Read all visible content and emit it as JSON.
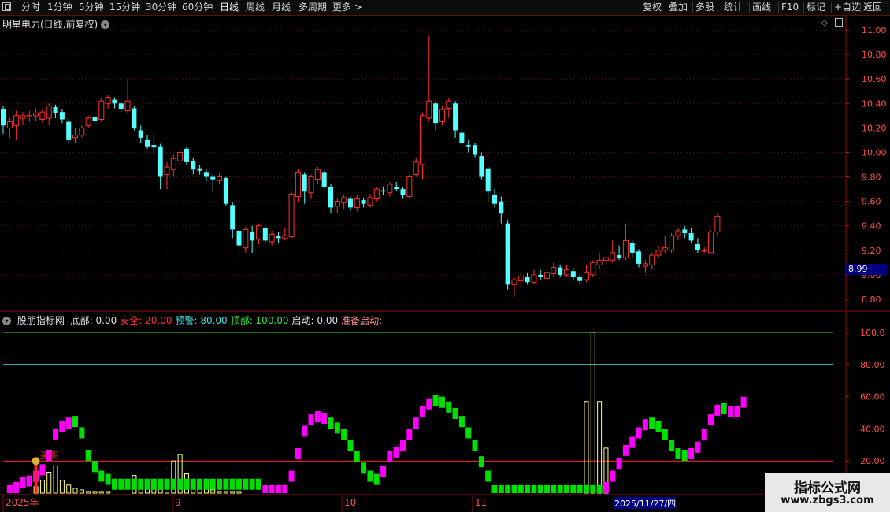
{
  "toolbar": {
    "periods": [
      "分时",
      "1分钟",
      "5分钟",
      "15分钟",
      "30分钟",
      "60分钟",
      "日线",
      "周线",
      "月线",
      "多周期",
      "更多 >"
    ],
    "active_period": "日线",
    "actions": [
      "复权",
      "叠加",
      "多股",
      "统计",
      "画线",
      "F10",
      "标记",
      "+自选",
      "返回"
    ]
  },
  "stock": {
    "title": "明星电力(日线,前复权)",
    "last_price_badge": "8.99"
  },
  "indicator": {
    "name": "股朋指标网",
    "items": [
      {
        "label": "底部:",
        "value": "0.00",
        "color": "#e0e0e0"
      },
      {
        "label": "安全:",
        "value": "20.00",
        "color": "#ff3030"
      },
      {
        "label": "预警:",
        "value": "80.00",
        "color": "#40e0e0"
      },
      {
        "label": "顶部:",
        "value": "100.00",
        "color": "#30e030"
      },
      {
        "label": "启动:",
        "value": "0.00",
        "color": "#e0e0e0"
      },
      {
        "label": "准备启动:",
        "value": "",
        "color": "#ff9090"
      }
    ],
    "buy_label": "买买"
  },
  "price_axis": [
    "11.00",
    "10.80",
    "10.60",
    "10.40",
    "10.20",
    "10.00",
    "9.80",
    "9.60",
    "9.40",
    "9.20",
    "9.00",
    "8.80"
  ],
  "indicator_axis": [
    "100.0",
    "80.00",
    "60.00",
    "40.00",
    "20.00"
  ],
  "date_axis": [
    "2025年",
    "9",
    "10",
    "11"
  ],
  "cursor_date": "2025/11/27/四",
  "watermark": {
    "line1": "指标公式网",
    "line2": "www.zbgs3.com"
  },
  "colors": {
    "up": "#ff3030",
    "down": "#54ffff",
    "ind_up": "#ff00ff",
    "ind_down": "#00e000",
    "low_bar": "#ffff80"
  },
  "chart_data": {
    "type": "candlestick",
    "price_ylim": [
      8.7,
      11.05
    ],
    "candles": [
      [
        10.35,
        10.22,
        10.38,
        10.15
      ],
      [
        10.2,
        10.25,
        10.28,
        10.12
      ],
      [
        10.22,
        10.3,
        10.34,
        10.1
      ],
      [
        10.28,
        10.3,
        10.33,
        10.22
      ],
      [
        10.29,
        10.3,
        10.34,
        10.25
      ],
      [
        10.3,
        10.32,
        10.36,
        10.26
      ],
      [
        10.27,
        10.33,
        10.35,
        10.24
      ],
      [
        10.28,
        10.38,
        10.4,
        10.22
      ],
      [
        10.37,
        10.32,
        10.39,
        10.28
      ],
      [
        10.33,
        10.27,
        10.35,
        10.24
      ],
      [
        10.25,
        10.1,
        10.27,
        10.08
      ],
      [
        10.12,
        10.14,
        10.2,
        10.08
      ],
      [
        10.14,
        10.2,
        10.22,
        10.12
      ],
      [
        10.22,
        10.28,
        10.3,
        10.2
      ],
      [
        10.29,
        10.26,
        10.32,
        10.22
      ],
      [
        10.27,
        10.42,
        10.44,
        10.25
      ],
      [
        10.4,
        10.45,
        10.47,
        10.35
      ],
      [
        10.43,
        10.4,
        10.45,
        10.36
      ],
      [
        10.4,
        10.35,
        10.42,
        10.33
      ],
      [
        10.34,
        10.42,
        10.6,
        10.32
      ],
      [
        10.36,
        10.2,
        10.38,
        10.18
      ],
      [
        10.18,
        10.12,
        10.22,
        10.08
      ],
      [
        10.1,
        10.05,
        10.14,
        10.03
      ],
      [
        10.06,
        10.04,
        10.15,
        9.99
      ],
      [
        10.05,
        9.8,
        10.07,
        9.7
      ],
      [
        9.82,
        9.88,
        9.92,
        9.7
      ],
      [
        9.86,
        9.95,
        9.98,
        9.8
      ],
      [
        9.93,
        10.0,
        10.03,
        9.9
      ],
      [
        10.03,
        9.92,
        10.05,
        9.9
      ],
      [
        9.93,
        9.86,
        9.96,
        9.82
      ],
      [
        9.87,
        9.85,
        9.9,
        9.82
      ],
      [
        9.84,
        9.8,
        9.86,
        9.76
      ],
      [
        9.8,
        9.78,
        9.82,
        9.67
      ],
      [
        9.77,
        9.8,
        9.83,
        9.74
      ],
      [
        9.79,
        9.58,
        9.8,
        9.56
      ],
      [
        9.57,
        9.37,
        9.59,
        9.3
      ],
      [
        9.36,
        9.24,
        9.39,
        9.1
      ],
      [
        9.22,
        9.37,
        9.39,
        9.18
      ],
      [
        9.35,
        9.28,
        9.4,
        9.18
      ],
      [
        9.29,
        9.4,
        9.42,
        9.25
      ],
      [
        9.38,
        9.28,
        9.4,
        9.26
      ],
      [
        9.27,
        9.33,
        9.36,
        9.24
      ],
      [
        9.32,
        9.3,
        9.35,
        9.26
      ],
      [
        9.3,
        9.32,
        9.38,
        9.28
      ],
      [
        9.31,
        9.66,
        9.68,
        9.3
      ],
      [
        9.64,
        9.84,
        9.86,
        9.6
      ],
      [
        9.82,
        9.68,
        9.84,
        9.58
      ],
      [
        9.67,
        9.8,
        9.82,
        9.62
      ],
      [
        9.78,
        9.86,
        9.88,
        9.74
      ],
      [
        9.84,
        9.72,
        9.86,
        9.7
      ],
      [
        9.72,
        9.55,
        9.74,
        9.5
      ],
      [
        9.56,
        9.6,
        9.62,
        9.5
      ],
      [
        9.59,
        9.63,
        9.65,
        9.54
      ],
      [
        9.62,
        9.55,
        9.64,
        9.52
      ],
      [
        9.55,
        9.62,
        9.65,
        9.52
      ],
      [
        9.61,
        9.58,
        9.63,
        9.55
      ],
      [
        9.57,
        9.63,
        9.66,
        9.55
      ],
      [
        9.62,
        9.7,
        9.72,
        9.6
      ],
      [
        9.69,
        9.68,
        9.72,
        9.65
      ],
      [
        9.67,
        9.74,
        9.76,
        9.64
      ],
      [
        9.72,
        9.7,
        9.76,
        9.68
      ],
      [
        9.7,
        9.65,
        9.72,
        9.62
      ],
      [
        9.64,
        9.8,
        9.82,
        9.62
      ],
      [
        9.82,
        9.92,
        9.96,
        9.8
      ],
      [
        9.9,
        10.3,
        10.32,
        9.78
      ],
      [
        10.28,
        10.42,
        10.95,
        10.25
      ],
      [
        10.4,
        10.24,
        10.42,
        10.18
      ],
      [
        10.25,
        10.35,
        10.38,
        10.22
      ],
      [
        10.36,
        10.42,
        10.44,
        10.28
      ],
      [
        10.4,
        10.18,
        10.42,
        10.12
      ],
      [
        10.16,
        10.08,
        10.2,
        10.05
      ],
      [
        10.06,
        10.05,
        10.1,
        10.0
      ],
      [
        10.06,
        9.98,
        10.08,
        9.96
      ],
      [
        9.97,
        9.8,
        10.0,
        9.78
      ],
      [
        9.87,
        9.68,
        9.88,
        9.6
      ],
      [
        9.65,
        9.58,
        9.7,
        9.55
      ],
      [
        9.6,
        9.5,
        9.64,
        9.42
      ],
      [
        9.42,
        8.92,
        9.45,
        8.88
      ],
      [
        8.92,
        8.96,
        8.98,
        8.82
      ],
      [
        8.95,
        8.99,
        9.02,
        8.9
      ],
      [
        8.98,
        8.94,
        9.02,
        8.92
      ],
      [
        8.94,
        9.0,
        9.04,
        8.92
      ],
      [
        9.0,
        8.98,
        9.04,
        8.96
      ],
      [
        8.97,
        9.02,
        9.06,
        8.95
      ],
      [
        9.01,
        9.06,
        9.1,
        8.98
      ],
      [
        9.06,
        9.0,
        9.08,
        8.98
      ],
      [
        9.0,
        9.04,
        9.08,
        8.98
      ],
      [
        9.03,
        8.98,
        9.06,
        8.95
      ],
      [
        8.98,
        8.95,
        9.0,
        8.92
      ],
      [
        8.96,
        9.02,
        9.08,
        8.94
      ],
      [
        9.0,
        9.1,
        9.12,
        8.98
      ],
      [
        9.08,
        9.12,
        9.18,
        9.05
      ],
      [
        9.12,
        9.14,
        9.2,
        9.06
      ],
      [
        9.12,
        9.18,
        9.28,
        9.1
      ],
      [
        9.16,
        9.14,
        9.24,
        9.12
      ],
      [
        9.14,
        9.28,
        9.42,
        9.12
      ],
      [
        9.26,
        9.18,
        9.28,
        9.14
      ],
      [
        9.19,
        9.09,
        9.21,
        9.06
      ],
      [
        9.07,
        9.09,
        9.12,
        9.02
      ],
      [
        9.08,
        9.16,
        9.18,
        9.05
      ],
      [
        9.16,
        9.2,
        9.24,
        9.14
      ],
      [
        9.2,
        9.22,
        9.32,
        9.18
      ],
      [
        9.2,
        9.32,
        9.34,
        9.18
      ],
      [
        9.32,
        9.36,
        9.38,
        9.28
      ],
      [
        9.37,
        9.34,
        9.4,
        9.3
      ],
      [
        9.34,
        9.28,
        9.38,
        9.26
      ],
      [
        9.25,
        9.2,
        9.3,
        9.18
      ],
      [
        9.2,
        9.2,
        9.23,
        9.18
      ],
      [
        9.18,
        9.35,
        9.36,
        9.18
      ],
      [
        9.35,
        9.48,
        9.5,
        9.32
      ]
    ],
    "indicator_ylim": [
      0,
      100
    ],
    "ref_lines": [
      20,
      80,
      100
    ],
    "indicator": [
      [
        0,
        "red"
      ],
      [
        3,
        "m"
      ],
      [
        5,
        "m"
      ],
      [
        8,
        "m"
      ],
      [
        9,
        "m"
      ],
      [
        12,
        "m"
      ],
      [
        16,
        "m"
      ],
      [
        25,
        "m"
      ],
      [
        38,
        "m"
      ],
      [
        43,
        "m"
      ],
      [
        45,
        "m"
      ],
      [
        46,
        "g"
      ],
      [
        39,
        "g"
      ],
      [
        25,
        "g"
      ],
      [
        18,
        "g"
      ],
      [
        12,
        "g"
      ],
      [
        10,
        "g"
      ],
      [
        7,
        "g"
      ],
      [
        7,
        "g"
      ],
      [
        7,
        "g"
      ],
      [
        7,
        "g"
      ],
      [
        7,
        "g"
      ],
      [
        7,
        "g"
      ],
      [
        7,
        "g"
      ],
      [
        7,
        "g"
      ],
      [
        7,
        "g"
      ],
      [
        7,
        "g"
      ],
      [
        7,
        "g"
      ],
      [
        7,
        "g"
      ],
      [
        7,
        "g"
      ],
      [
        7,
        "g"
      ],
      [
        7,
        "g"
      ],
      [
        7,
        "g"
      ],
      [
        7,
        "g"
      ],
      [
        7,
        "g"
      ],
      [
        7,
        "g"
      ],
      [
        7,
        "g"
      ],
      [
        7,
        "g"
      ],
      [
        7,
        "g"
      ],
      [
        7,
        "g"
      ],
      [
        3,
        "m"
      ],
      [
        3,
        "m"
      ],
      [
        3,
        "m"
      ],
      [
        3,
        "m"
      ],
      [
        12,
        "m"
      ],
      [
        26,
        "m"
      ],
      [
        40,
        "m"
      ],
      [
        47,
        "m"
      ],
      [
        49,
        "m"
      ],
      [
        48,
        "m"
      ],
      [
        45,
        "g"
      ],
      [
        42,
        "g"
      ],
      [
        38,
        "g"
      ],
      [
        31,
        "g"
      ],
      [
        24,
        "g"
      ],
      [
        17,
        "g"
      ],
      [
        12,
        "g"
      ],
      [
        10,
        "g"
      ],
      [
        15,
        "m"
      ],
      [
        24,
        "m"
      ],
      [
        27,
        "m"
      ],
      [
        31,
        "m"
      ],
      [
        38,
        "m"
      ],
      [
        45,
        "m"
      ],
      [
        52,
        "m"
      ],
      [
        57,
        "m"
      ],
      [
        59,
        "g"
      ],
      [
        58,
        "g"
      ],
      [
        55,
        "g"
      ],
      [
        51,
        "g"
      ],
      [
        46,
        "g"
      ],
      [
        39,
        "g"
      ],
      [
        31,
        "g"
      ],
      [
        21,
        "g"
      ],
      [
        12,
        "g"
      ],
      [
        3,
        "g"
      ],
      [
        3,
        "g"
      ],
      [
        3,
        "g"
      ],
      [
        3,
        "g"
      ],
      [
        3,
        "g"
      ],
      [
        3,
        "g"
      ],
      [
        3,
        "g"
      ],
      [
        3,
        "g"
      ],
      [
        3,
        "g"
      ],
      [
        3,
        "g"
      ],
      [
        3,
        "g"
      ],
      [
        3,
        "g"
      ],
      [
        3,
        "g"
      ],
      [
        3,
        "g"
      ],
      [
        3,
        "g"
      ],
      [
        3,
        "g"
      ],
      [
        3,
        "g"
      ],
      [
        5,
        "m"
      ],
      [
        12,
        "m"
      ],
      [
        20,
        "m"
      ],
      [
        28,
        "m"
      ],
      [
        33,
        "m"
      ],
      [
        39,
        "m"
      ],
      [
        44,
        "m"
      ],
      [
        45,
        "g"
      ],
      [
        43,
        "g"
      ],
      [
        38,
        "g"
      ],
      [
        31,
        "g"
      ],
      [
        26,
        "g"
      ],
      [
        25,
        "g"
      ],
      [
        26,
        "m"
      ],
      [
        30,
        "m"
      ],
      [
        38,
        "m"
      ],
      [
        47,
        "m"
      ],
      [
        53,
        "m"
      ],
      [
        54,
        "g"
      ],
      [
        52,
        "m"
      ],
      [
        52,
        "m"
      ],
      [
        58,
        "m"
      ]
    ],
    "low_bars": [
      0,
      0,
      0,
      0,
      0,
      4,
      8,
      13,
      17,
      8,
      5,
      3,
      2,
      1,
      1,
      1,
      1,
      0,
      0,
      0,
      11,
      8,
      5,
      3,
      7,
      15,
      20,
      24,
      12,
      8,
      5,
      3,
      2,
      1,
      1,
      1,
      1,
      0,
      0,
      0,
      0,
      0,
      0,
      0,
      0,
      0,
      0,
      0,
      0,
      0,
      0,
      0,
      0,
      0,
      0,
      0,
      0,
      0,
      0,
      0,
      0,
      0,
      0,
      0,
      0,
      0,
      0,
      0,
      0,
      0,
      0,
      0,
      0,
      0,
      0,
      0,
      0,
      0,
      0,
      0,
      0,
      0,
      0,
      0,
      0,
      0,
      0,
      0,
      0,
      0,
      0,
      0,
      0,
      0,
      0,
      0,
      0,
      0,
      0,
      0,
      0,
      0,
      0,
      0,
      0,
      0,
      0,
      0,
      0,
      0
    ]
  }
}
